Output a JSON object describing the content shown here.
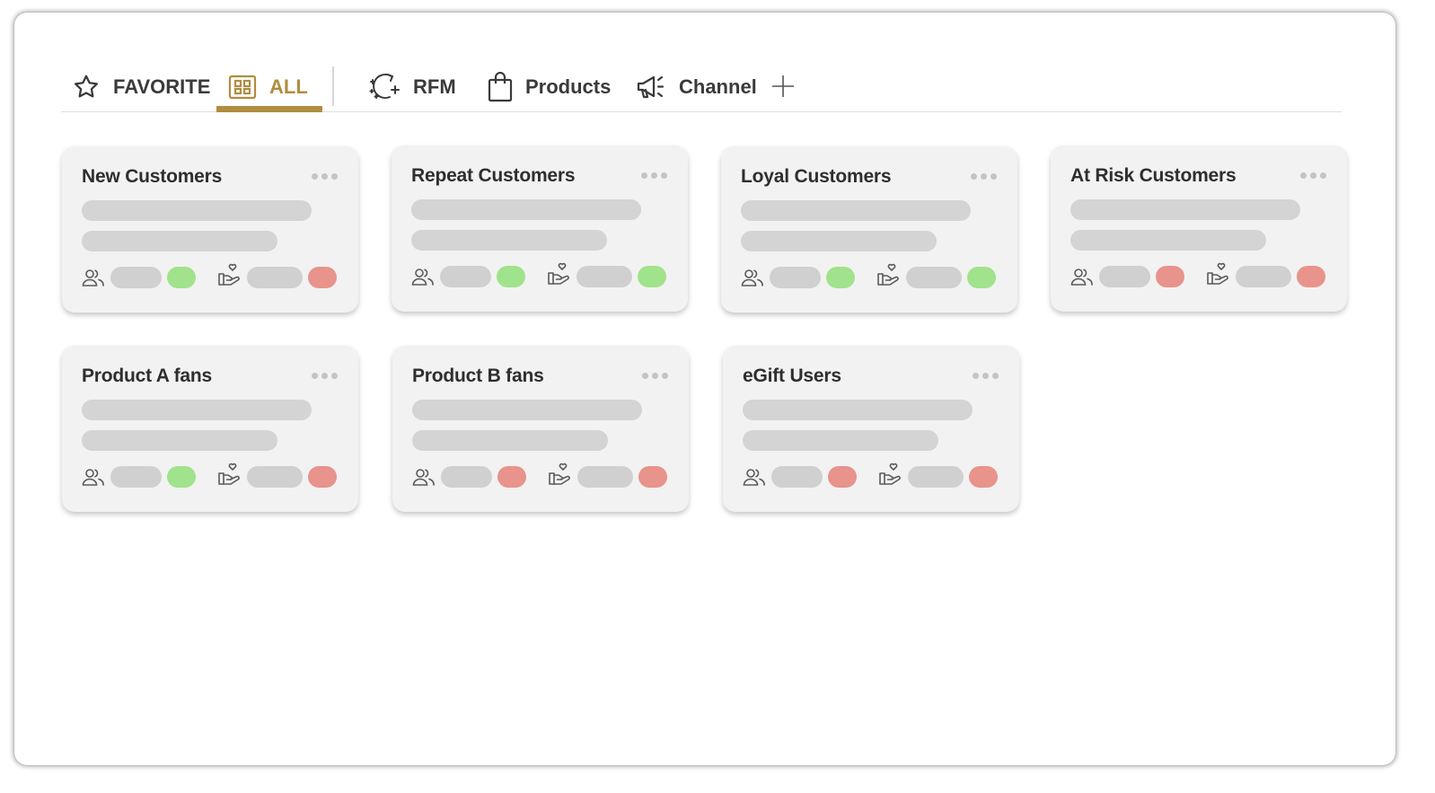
{
  "colors": {
    "accent": "#b08d3f",
    "good": "#a0e38c",
    "bad": "#e8938b",
    "skeleton": "#d4d4d4",
    "card_bg": "#f2f2f2"
  },
  "tabs": [
    {
      "label": "FAVORITE",
      "icon": "star-icon",
      "active": false
    },
    {
      "label": "ALL",
      "icon": "grid-icon",
      "active": true
    },
    {
      "label": "RFM",
      "icon": "sparkle-refresh-icon",
      "active": false
    },
    {
      "label": "Products",
      "icon": "shopping-bag-icon",
      "active": false
    },
    {
      "label": "Channel",
      "icon": "megaphone-icon",
      "active": false
    }
  ],
  "add_tab_icon": "plus-icon",
  "stat_icons": [
    "people-icon",
    "hand-heart-icon"
  ],
  "cards": [
    {
      "title": "New Customers",
      "status": [
        "good",
        "bad"
      ]
    },
    {
      "title": "Repeat Customers",
      "status": [
        "good",
        "good"
      ]
    },
    {
      "title": "Loyal Customers",
      "status": [
        "good",
        "good"
      ]
    },
    {
      "title": "At Risk Customers",
      "status": [
        "bad",
        "bad"
      ]
    },
    {
      "title": "Product A fans",
      "status": [
        "good",
        "bad"
      ]
    },
    {
      "title": "Product B fans",
      "status": [
        "bad",
        "bad"
      ]
    },
    {
      "title": "eGift Users",
      "status": [
        "bad",
        "bad"
      ]
    }
  ]
}
